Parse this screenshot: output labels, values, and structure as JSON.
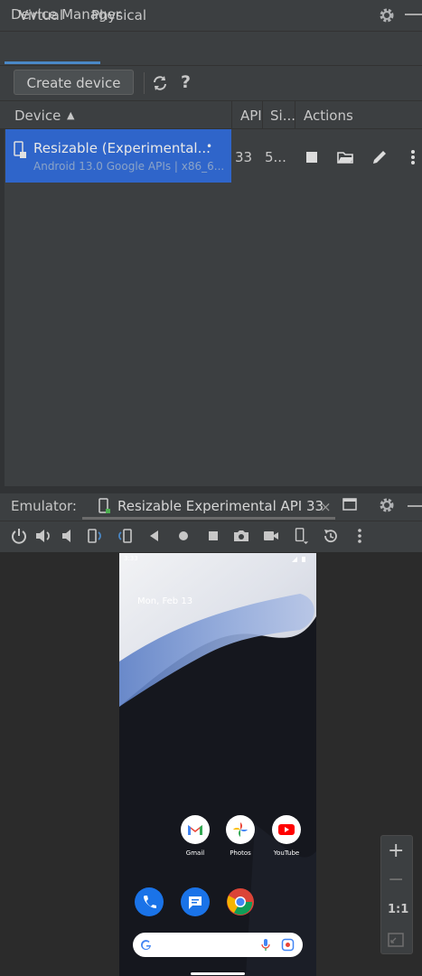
{
  "device_manager": {
    "title": "Device Manager",
    "tabs": [
      {
        "label": "Virtual",
        "active": true
      },
      {
        "label": "Physical",
        "active": false
      }
    ],
    "toolbar": {
      "create_label": "Create device",
      "refresh_icon": "refresh-icon",
      "help_label": "?"
    },
    "columns": [
      "Device",
      "API",
      "Si...",
      "Actions"
    ],
    "sort_indicator": "▲",
    "rows": [
      {
        "name": "Resizable (Experimental...",
        "running_indicator": "•",
        "subtitle": "Android 13.0 Google APIs | x86_6...",
        "api": "33",
        "size": "5...",
        "actions": [
          "stop-icon",
          "folder-icon",
          "edit-icon",
          "more-icon"
        ],
        "selected": true
      }
    ]
  },
  "emulator": {
    "label": "Emulator:",
    "tab_title": "Resizable Experimental API 33",
    "close_glyph": "×",
    "tools": [
      "power-icon",
      "volume-up-icon",
      "volume-down-icon",
      "rotate-left-icon",
      "rotate-right-icon",
      "back-icon",
      "home-icon",
      "overview-icon",
      "screenshot-icon",
      "record-icon",
      "device-posture-icon",
      "snapshot-icon",
      "more-icon"
    ]
  },
  "phone": {
    "status_time": "3:33",
    "date": "Mon, Feb 13",
    "apps_row1": [
      {
        "label": "Gmail"
      },
      {
        "label": "Photos"
      },
      {
        "label": "YouTube"
      }
    ],
    "dock": [
      "phone-app-icon",
      "messages-app-icon",
      "chrome-app-icon"
    ]
  },
  "zoom": {
    "plus": "+",
    "minus": "−",
    "one_to_one": "1:1"
  },
  "colors": {
    "accent": "#4a88c7",
    "selection": "#2f65ca",
    "background": "#3c3f41"
  }
}
